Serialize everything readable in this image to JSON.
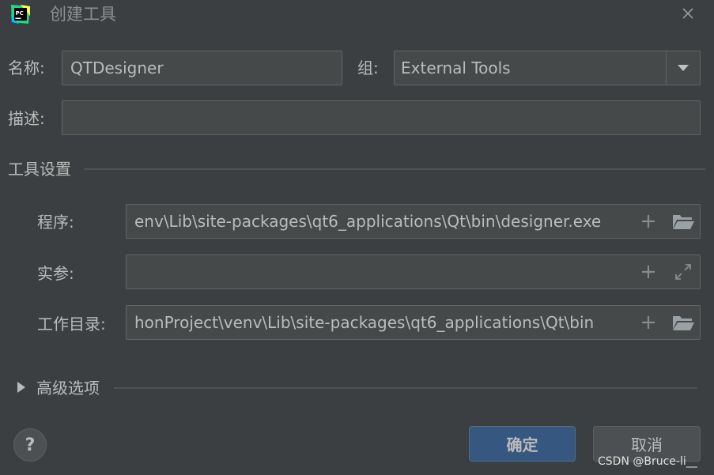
{
  "dialog": {
    "title": "创建工具",
    "close_icon": "close-icon"
  },
  "form": {
    "name_label": "名称:",
    "name_value": "QTDesigner",
    "group_label": "组:",
    "group_value": "External Tools",
    "description_label": "描述:",
    "description_value": ""
  },
  "tool_settings": {
    "section_title": "工具设置",
    "program_label": "程序:",
    "program_value": "env\\Lib\\site-packages\\qt6_applications\\Qt\\bin\\designer.exe",
    "arguments_label": "实参:",
    "arguments_value": "",
    "working_dir_label": "工作目录:",
    "working_dir_value": "honProject\\venv\\Lib\\site-packages\\qt6_applications\\Qt\\bin"
  },
  "advanced": {
    "section_title": "高级选项"
  },
  "buttons": {
    "help": "?",
    "ok": "确定",
    "cancel": "取消"
  },
  "watermark": "CSDN @Bruce-li__",
  "colors": {
    "background": "#3c3f41",
    "field_bg": "#45494a",
    "primary_button": "#365880",
    "text": "#bbbbbb"
  }
}
